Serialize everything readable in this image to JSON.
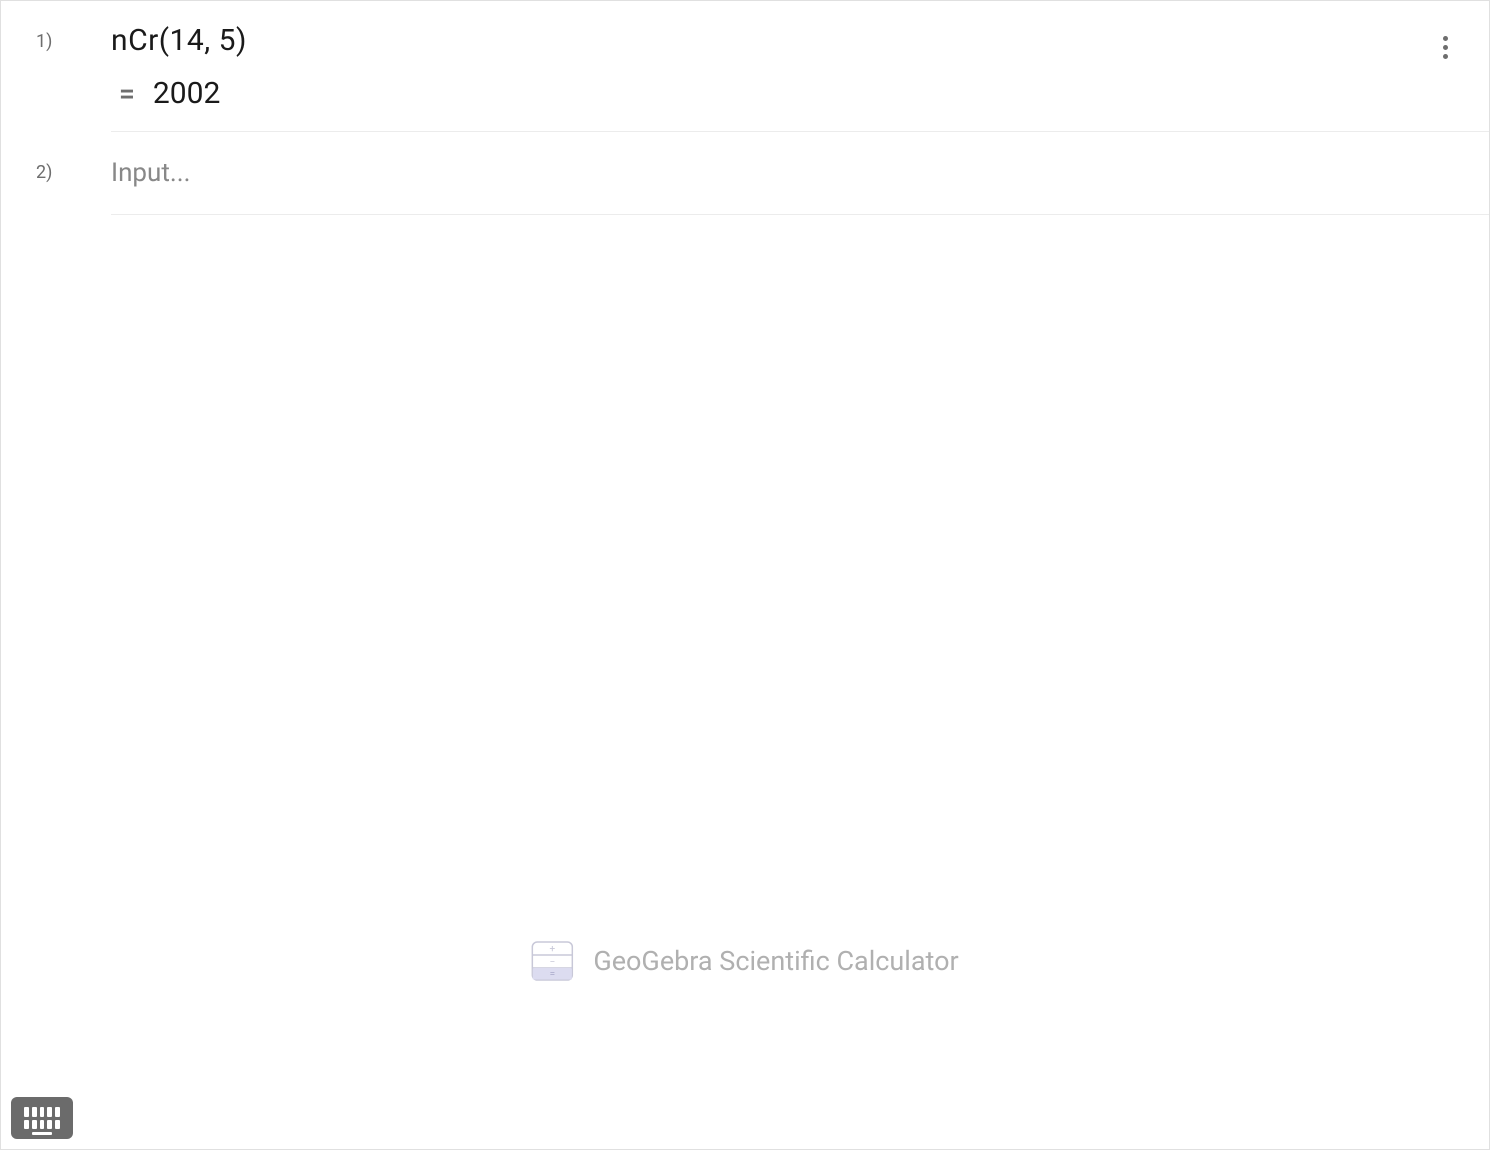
{
  "rows": [
    {
      "number": "1)",
      "expression": "nCr(14, 5)",
      "equals": "=",
      "result": "2002"
    },
    {
      "number": "2)",
      "placeholder": "Input..."
    }
  ],
  "branding": {
    "text": "GeoGebra Scientific Calculator"
  }
}
